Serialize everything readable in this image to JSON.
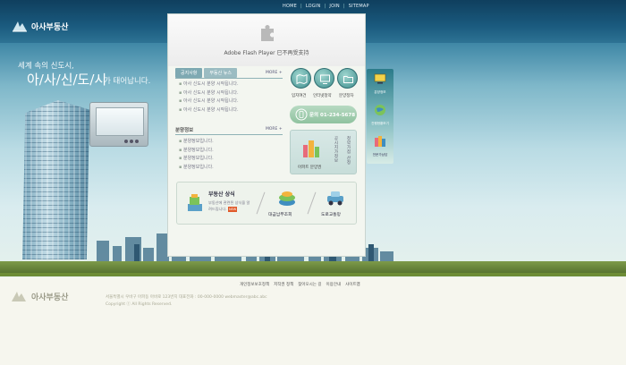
{
  "header": {
    "nav": [
      "HOME",
      "LOGIN",
      "JOIN",
      "SITEMAP"
    ],
    "logo_text": "아사부동산"
  },
  "hero": {
    "slogan_line1": "세계 속의 신도시,",
    "slogan_line2": "아/사/신/도/시",
    "slogan_line3": "가 태어납니다."
  },
  "flash": {
    "message": "Adobe Flash Player 已不再受支持"
  },
  "notice": {
    "tabs": [
      "공지사항",
      "부동산 뉴스"
    ],
    "more": "MORE +",
    "items": [
      "아사 신도시 분양 시작됩니다.",
      "아사 신도시 분양 시작됩니다.",
      "아사 신도시 분양 시작됩니다.",
      "아사 신도시 분양 시작됩니다."
    ]
  },
  "sale_info": {
    "title": "분양정보",
    "more": "MORE +",
    "items": [
      "분양정보입니다.",
      "분양정보입니다.",
      "분양정보입니다.",
      "분양정보입니다."
    ]
  },
  "quick_buttons": [
    {
      "label": "입지여건",
      "icon": "map-icon"
    },
    {
      "label": "인터넷청약",
      "icon": "monitor-icon"
    },
    {
      "label": "분양정차",
      "icon": "folder-icon"
    }
  ],
  "phone": {
    "label": "문의 01-234-5678",
    "icon": "phone-icon"
  },
  "apt_box": {
    "label": "아파트 분양권",
    "vtext1": "공시지가정보",
    "vtext2": "청약가점 산정"
  },
  "realestate": {
    "title": "부동산 상식",
    "desc": "부동산에 관련된 상식을 알려드립니다.",
    "badge": "NEW",
    "loan_label": "대금납부조회",
    "road_label": "도로교통망"
  },
  "quick_menu": [
    {
      "label": "분양정보",
      "icon": "screen-icon"
    },
    {
      "label": "진행현황보기",
      "icon": "globe-icon"
    },
    {
      "label": "전문가상담",
      "icon": "books-icon"
    }
  ],
  "footer": {
    "links": [
      "개인정보보호정책",
      "저작권 정책",
      "찾아오시는 길",
      "이용안내",
      "사이트맵"
    ],
    "logo_text": "아사부동산",
    "address": "서울특별시 우바구 아파동 아바로 123번지 대표전화 : 00-000-0000 webmaster@abc.abc",
    "copyright": "Copyright ⓒ All Rights Reserved."
  },
  "colors": {
    "header_bg": "#1a5a7e",
    "accent_teal": "#3f8e8e",
    "footer_bg": "#f6f6ee"
  }
}
